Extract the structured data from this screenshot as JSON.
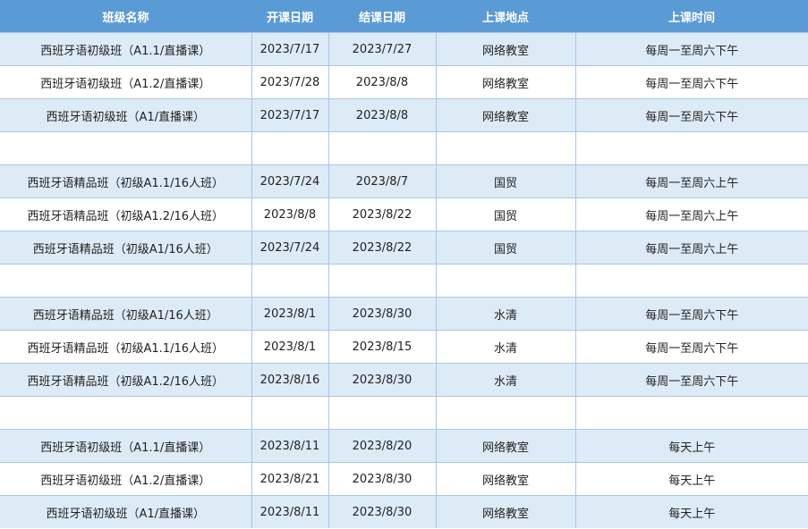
{
  "table": {
    "headers": [
      "班级名称",
      "开课日期",
      "结课日期",
      "上课地点",
      "上课时间"
    ],
    "rows": [
      [
        "西班牙语初级班（A1.1/直播课）",
        "2023/7/17",
        "2023/7/27",
        "网络教室",
        "每周一至周六下午"
      ],
      [
        "西班牙语初级班（A1.2/直播课）",
        "2023/7/28",
        "2023/8/8",
        "网络教室",
        "每周一至周六下午"
      ],
      [
        "西班牙语初级班（A1/直播课）",
        "2023/7/17",
        "2023/8/8",
        "网络教室",
        "每周一至周六下午"
      ],
      [
        "",
        "",
        "",
        "",
        ""
      ],
      [
        "西班牙语精品班（初级A1.1/16人班）",
        "2023/7/24",
        "2023/8/7",
        "国贸",
        "每周一至周六上午"
      ],
      [
        "西班牙语精品班（初级A1.2/16人班）",
        "2023/8/8",
        "2023/8/22",
        "国贸",
        "每周一至周六上午"
      ],
      [
        "西班牙语精品班（初级A1/16人班）",
        "2023/7/24",
        "2023/8/22",
        "国贸",
        "每周一至周六上午"
      ],
      [
        "",
        "",
        "",
        "",
        ""
      ],
      [
        "西班牙语精品班（初级A1/16人班）",
        "2023/8/1",
        "2023/8/30",
        "水清",
        "每周一至周六下午"
      ],
      [
        "西班牙语精品班（初级A1.1/16人班）",
        "2023/8/1",
        "2023/8/15",
        "水清",
        "每周一至周六下午"
      ],
      [
        "西班牙语精品班（初级A1.2/16人班）",
        "2023/8/16",
        "2023/8/30",
        "水清",
        "每周一至周六下午"
      ],
      [
        "",
        "",
        "",
        "",
        ""
      ],
      [
        "西班牙语初级班（A1.1/直播课）",
        "2023/8/11",
        "2023/8/20",
        "网络教室",
        "每天上午"
      ],
      [
        "西班牙语初级班（A1.2/直播课）",
        "2023/8/21",
        "2023/8/30",
        "网络教室",
        "每天上午"
      ],
      [
        "西班牙语初级班（A1/直播课）",
        "2023/8/11",
        "2023/8/30",
        "网络教室",
        "每天上午"
      ]
    ]
  }
}
